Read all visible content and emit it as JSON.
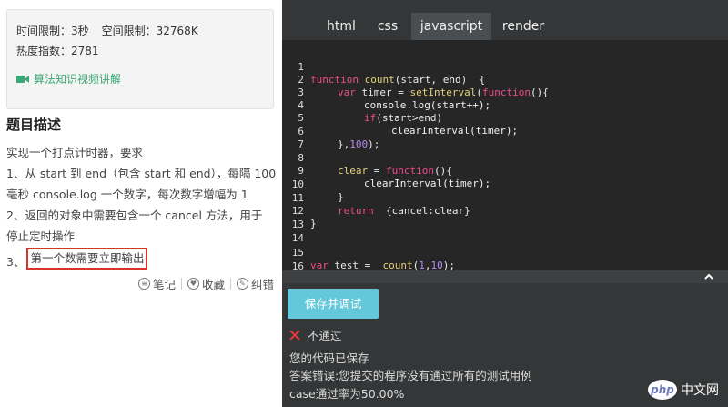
{
  "problem": {
    "time_limit": "时间限制：3秒",
    "space_limit": "空间限制：32768K",
    "hot_index": "热度指数：2781",
    "video_link": "算法知识视频讲解",
    "section_title": "题目描述",
    "desc_lines": [
      "实现一个打点计时器，要求",
      "1、从 start 到 end（包含 start 和 end），每隔 100",
      "毫秒 console.log 一个数字，每次数字增幅为 1",
      "2、返回的对象中需要包含一个 cancel 方法，用于",
      "停止定时操作"
    ],
    "item3_prefix": "3、",
    "item3_highlight": "第一个数需要立即输出",
    "actions": {
      "note": "笔记",
      "favorite": "收藏",
      "report": "纠错"
    }
  },
  "editor": {
    "tabs": [
      "html",
      "css",
      "javascript",
      "render"
    ],
    "active_tab": "javascript",
    "line_numbers": [
      "1",
      "2",
      "3",
      "4",
      "5",
      "6",
      "7",
      "8",
      "9",
      "10",
      "11",
      "12",
      "13",
      "14",
      "15",
      "16"
    ],
    "code": {
      "l1": {
        "kw": "function",
        "fn": "count",
        "rest": "(start, end)  {"
      },
      "l2": {
        "kw": "var",
        "name": " timer = ",
        "fn": "setInterval",
        "rest": "(",
        "kw2": "function",
        "rest2": "(){"
      },
      "l3": {
        "text": "console.log(start++);"
      },
      "l4": {
        "kw": "if",
        "rest": "(start>end)"
      },
      "l5": {
        "text": "clearInterval(timer);"
      },
      "l6": {
        "pre": "},",
        "num": "100",
        "post": ");"
      },
      "l8": {
        "name": "clear",
        "eq": " = ",
        "kw": "function",
        "rest": "(){"
      },
      "l9": {
        "text": "clearInterval(timer);"
      },
      "l10": {
        "text": "}"
      },
      "l11": {
        "kw": "return",
        "rest": "  {cancel:clear}"
      },
      "l12": {
        "text": "}"
      },
      "l15": {
        "kw": "var",
        "name": " test = ",
        "fn": "count",
        "pre": "(",
        "n1": "1",
        "comma": ",",
        "n2": "10",
        "post": ");"
      }
    }
  },
  "result": {
    "save_button": "保存并调试",
    "status": "不通过",
    "saved": "您的代码已保存",
    "error": "答案错误:您提交的程序没有通过所有的测试用例",
    "pass_rate": "case通过率为50.00%"
  },
  "watermark": {
    "logo": "php",
    "text": "中文网"
  },
  "colors": {
    "editor_bg": "#262626",
    "panel_bg": "#343637",
    "keyword": "#ea4d8a",
    "function_name": "#e6d27a",
    "number": "#b48cf0",
    "save_button": "#63c8d9",
    "highlight_border": "#d9342b",
    "link": "#3aa876",
    "fail_icon": "#e33b3b"
  },
  "icons": {
    "video": "video-camera-icon",
    "note": "note-icon",
    "favorite": "heart-icon",
    "report": "pencil-icon",
    "fail": "close-icon",
    "scroll": "chevron-up-icon"
  }
}
